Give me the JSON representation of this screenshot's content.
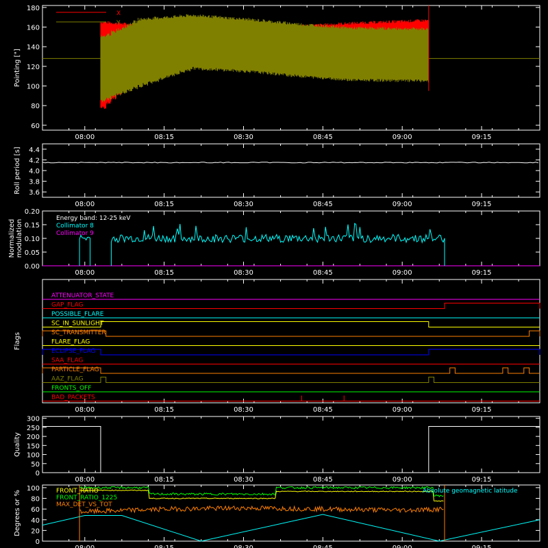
{
  "chart_data": [
    {
      "id": "pointing",
      "type": "line",
      "ylabel": "Pointing [\"]",
      "ylim": [
        55,
        182
      ],
      "yticks": [
        60,
        80,
        100,
        120,
        140,
        160,
        180
      ],
      "xlim": [
        "07:52",
        "09:26"
      ],
      "xticks": [
        "08:00",
        "08:15",
        "08:30",
        "08:45",
        "09:00",
        "09:15"
      ],
      "legend": [
        {
          "name": "X",
          "color": "#ff0000"
        },
        {
          "name": "Y",
          "color": "#808000"
        }
      ],
      "baseline": 128,
      "active_range": [
        "08:03",
        "09:05"
      ],
      "series": [
        {
          "name": "X",
          "color": "#ff0000",
          "upper": [
            [
              "08:03",
              165
            ],
            [
              "08:10",
              162
            ],
            [
              "08:20",
              160
            ],
            [
              "08:30",
              158
            ],
            [
              "08:40",
              161
            ],
            [
              "08:50",
              164
            ],
            [
              "09:05",
              167
            ]
          ],
          "lower": [
            [
              "08:03",
              78
            ],
            [
              "08:10",
              110
            ],
            [
              "08:20",
              125
            ],
            [
              "08:30",
              122
            ],
            [
              "08:40",
              118
            ],
            [
              "08:50",
              116
            ],
            [
              "09:05",
              118
            ]
          ]
        },
        {
          "name": "Y",
          "color": "#808000",
          "upper": [
            [
              "08:03",
              150
            ],
            [
              "08:10",
              168
            ],
            [
              "08:20",
              172
            ],
            [
              "08:30",
              168
            ],
            [
              "08:40",
              163
            ],
            [
              "08:50",
              159
            ],
            [
              "09:05",
              158
            ]
          ],
          "lower": [
            [
              "08:03",
              85
            ],
            [
              "08:10",
              100
            ],
            [
              "08:20",
              118
            ],
            [
              "08:30",
              115
            ],
            [
              "08:40",
              110
            ],
            [
              "08:50",
              106
            ],
            [
              "09:05",
              105
            ]
          ]
        }
      ]
    },
    {
      "id": "roll",
      "type": "line",
      "ylabel": "Roll period [s]",
      "ylim": [
        3.5,
        4.5
      ],
      "yticks": [
        3.6,
        3.8,
        4.0,
        4.2,
        4.4
      ],
      "ytick_labels": [
        "3.6",
        "3.8",
        "4.0",
        "4.2",
        "4.4"
      ],
      "xticks": [
        "08:00",
        "08:15",
        "08:30",
        "08:45",
        "09:00",
        "09:15"
      ],
      "value": 4.15
    },
    {
      "id": "modulation",
      "type": "line",
      "ylabel": "Normalized modulation",
      "ylim": [
        0,
        0.2
      ],
      "yticks": [
        0.0,
        0.05,
        0.1,
        0.15,
        0.2
      ],
      "ytick_labels": [
        "0.00",
        "0.05",
        "0.10",
        "0.15",
        "0.20"
      ],
      "xticks": [
        "08:00",
        "08:15",
        "08:30",
        "08:45",
        "09:00",
        "09:15"
      ],
      "legend": [
        {
          "name": "Energy band: 12-25 keV",
          "color": "#ffffff"
        },
        {
          "name": "Collimator 8",
          "color": "#00ffff"
        },
        {
          "name": "Collimator 9",
          "color": "#ff00ff"
        }
      ],
      "series": [
        {
          "name": "Collimator 8",
          "color": "#00ffff",
          "segments": [
            [
              "07:59",
              "08:01"
            ],
            [
              "08:05",
              "09:08"
            ]
          ],
          "level": 0.1
        },
        {
          "name": "Collimator 9",
          "color": "#ff00ff",
          "level": 0.0
        }
      ]
    },
    {
      "id": "flags",
      "type": "line",
      "ylabel": "Flags",
      "xticks": [
        "08:00",
        "08:15",
        "08:30",
        "08:45",
        "09:00",
        "09:15"
      ],
      "flags": [
        {
          "name": "ATTENUATOR_STATE",
          "color": "#ff00ff",
          "on": []
        },
        {
          "name": "GAP_FLAG",
          "color": "#ff0000",
          "on": [
            [
              "09:08",
              "09:26"
            ]
          ]
        },
        {
          "name": "POSSIBLE_FLARE",
          "color": "#00ffff",
          "on": []
        },
        {
          "name": "SC_IN_SUNLIGHT",
          "color": "#ffff00",
          "on": [
            [
              "08:03",
              "09:05"
            ]
          ]
        },
        {
          "name": "SC_TRANSMITTER",
          "color": "#ff8000",
          "on": [
            [
              "07:52",
              "08:04"
            ],
            [
              "09:24",
              "09:26"
            ]
          ]
        },
        {
          "name": "FLARE_FLAG",
          "color": "#ffff00",
          "on": []
        },
        {
          "name": "ECLIPSE_FLAG",
          "color": "#0000ff",
          "on": [
            [
              "07:52",
              "08:03"
            ],
            [
              "09:05",
              "09:26"
            ]
          ]
        },
        {
          "name": "SAA_FLAG",
          "color": "#ff0000",
          "on": []
        },
        {
          "name": "PARTICLE_FLAG",
          "color": "#ff8000",
          "on": [
            [
              "07:52",
              "08:03"
            ],
            [
              "09:09",
              "09:10"
            ],
            [
              "09:19",
              "09:20"
            ],
            [
              "09:23",
              "09:24"
            ]
          ]
        },
        {
          "name": "AAZ_FLAG",
          "color": "#808000",
          "on": [
            [
              "08:03",
              "08:04"
            ],
            [
              "09:05",
              "09:06"
            ]
          ]
        },
        {
          "name": "FRONTS_OFF",
          "color": "#00ff00",
          "on": []
        },
        {
          "name": "BAD_PACKETS",
          "color": "#ff0000",
          "spikes": [
            "08:41",
            "08:49"
          ]
        }
      ]
    },
    {
      "id": "quality",
      "type": "line",
      "ylabel": "Quality",
      "ylim": [
        0,
        310
      ],
      "yticks": [
        0,
        50,
        100,
        150,
        200,
        250,
        300
      ],
      "xticks": [
        "08:00",
        "08:15",
        "08:30",
        "08:45",
        "09:00",
        "09:15"
      ],
      "segments": [
        {
          "x0": "07:52",
          "x1": "08:03",
          "value": 255
        },
        {
          "x0": "08:03",
          "x1": "09:05",
          "value": 0
        },
        {
          "x0": "09:05",
          "x1": "09:26",
          "value": 255
        }
      ]
    },
    {
      "id": "ratios",
      "type": "line",
      "ylabel": "Degrees or %",
      "ylim": [
        0,
        105
      ],
      "yticks": [
        0,
        20,
        40,
        60,
        80,
        100
      ],
      "xticks": [
        "08:00",
        "08:15",
        "08:30",
        "08:45",
        "09:00",
        "09:15"
      ],
      "legend": [
        {
          "name": "FRONT_RATIO",
          "color": "#ffff00"
        },
        {
          "name": "FRONT_RATIO_1225",
          "color": "#00ff00"
        },
        {
          "name": "MAX_DET_VS_TOT",
          "color": "#ff8000"
        },
        {
          "name": "Absolute geomagnetic latitude",
          "color": "#00ffff"
        }
      ],
      "series": [
        {
          "name": "FRONT_RATIO",
          "color": "#ffff00",
          "points": [
            [
              "07:59",
              95
            ],
            [
              "08:11",
              95
            ],
            [
              "08:11",
              80
            ],
            [
              "08:35",
              80
            ],
            [
              "08:35",
              93
            ],
            [
              "09:05",
              93
            ],
            [
              "09:05",
              75
            ],
            [
              "09:08",
              75
            ]
          ]
        },
        {
          "name": "FRONT_RATIO_1225",
          "color": "#00ff00",
          "points": [
            [
              "07:59",
              100
            ],
            [
              "08:11",
              100
            ],
            [
              "08:11",
              88
            ],
            [
              "08:35",
              88
            ],
            [
              "08:35",
              100
            ],
            [
              "09:05",
              100
            ],
            [
              "09:05",
              85
            ],
            [
              "09:08",
              85
            ]
          ]
        },
        {
          "name": "MAX_DET_VS_TOT",
          "color": "#ff8000",
          "points": [
            [
              "07:59",
              55
            ],
            [
              "08:15",
              60
            ],
            [
              "08:30",
              62
            ],
            [
              "08:45",
              60
            ],
            [
              "09:00",
              58
            ],
            [
              "09:08",
              60
            ]
          ]
        },
        {
          "name": "Absolute geomagnetic latitude",
          "color": "#00ffff",
          "points": [
            [
              "07:52",
              30
            ],
            [
              "08:00",
              48
            ],
            [
              "08:07",
              48
            ],
            [
              "08:22",
              0
            ],
            [
              "08:45",
              50
            ],
            [
              "09:07",
              0
            ],
            [
              "09:26",
              40
            ]
          ]
        }
      ],
      "red_markers": [
        "07:59",
        "09:08"
      ]
    }
  ]
}
